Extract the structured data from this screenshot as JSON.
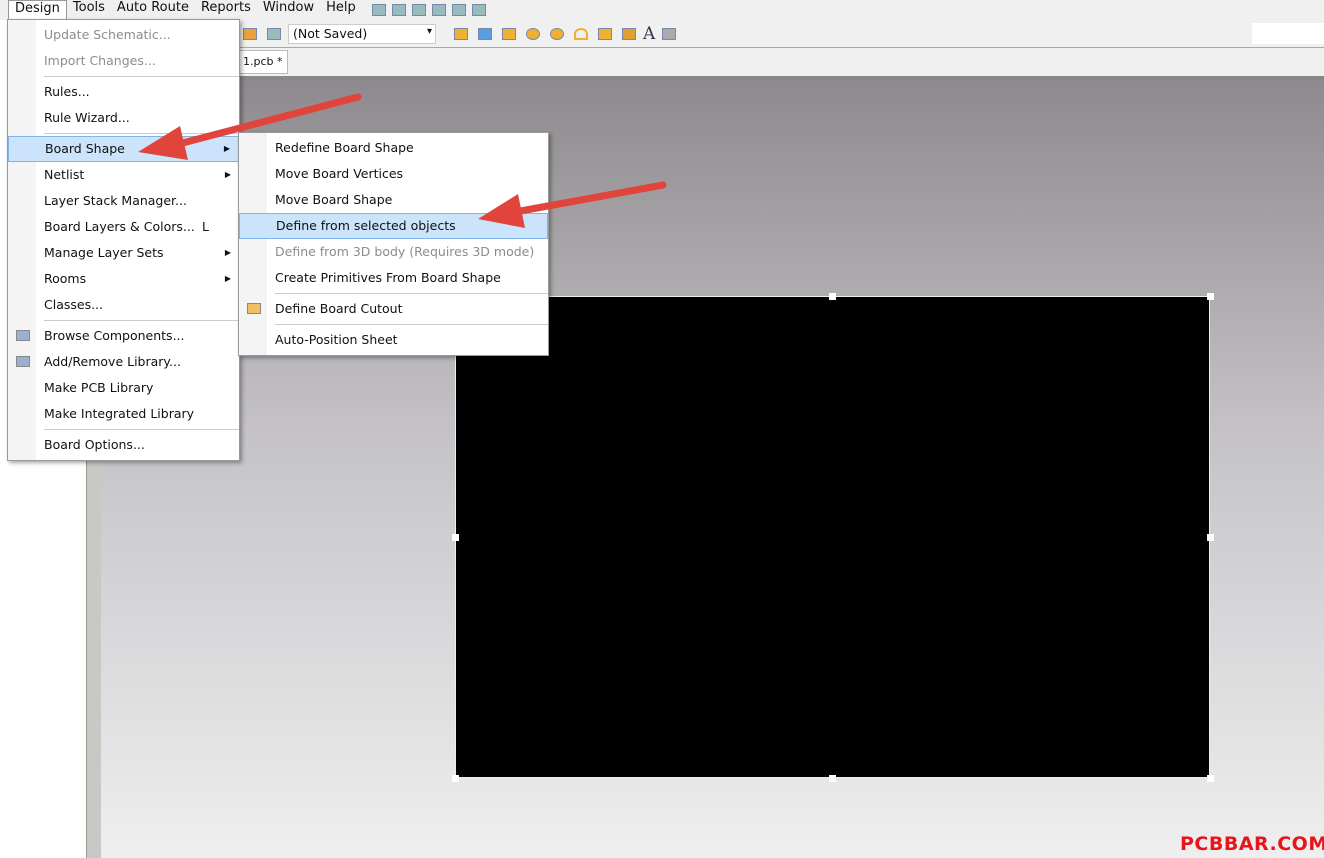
{
  "menubar": {
    "items": [
      "Design",
      "Tools",
      "Auto Route",
      "Reports",
      "Window",
      "Help"
    ]
  },
  "toolbar": {
    "saved_select": "(Not Saved)"
  },
  "document_tab": "1.pcb *",
  "design_menu": {
    "items": [
      {
        "label": "Update Schematic...",
        "disabled": true
      },
      {
        "label": "Import Changes...",
        "disabled": true
      },
      {
        "sep": true
      },
      {
        "label": "Rules..."
      },
      {
        "label": "Rule Wizard..."
      },
      {
        "sep": true
      },
      {
        "label": "Board Shape",
        "submenu": true,
        "highlighted": true
      },
      {
        "label": "Netlist",
        "submenu": true
      },
      {
        "label": "Layer Stack Manager..."
      },
      {
        "label": "Board Layers & Colors...",
        "shortcut": "L"
      },
      {
        "label": "Manage Layer Sets",
        "submenu": true
      },
      {
        "label": "Rooms",
        "submenu": true
      },
      {
        "label": "Classes..."
      },
      {
        "sep": true
      },
      {
        "label": "Browse Components...",
        "icon": "browse-components-icon"
      },
      {
        "label": "Add/Remove Library...",
        "icon": "library-book-icon"
      },
      {
        "label": "Make PCB Library"
      },
      {
        "label": "Make Integrated Library"
      },
      {
        "sep": true
      },
      {
        "label": "Board Options..."
      }
    ]
  },
  "board_shape_submenu": {
    "items": [
      {
        "label": "Redefine Board Shape"
      },
      {
        "label": "Move Board Vertices"
      },
      {
        "label": "Move Board Shape"
      },
      {
        "label": "Define from selected objects",
        "highlighted": true
      },
      {
        "label": "Define from 3D body (Requires 3D mode)",
        "disabled": true
      },
      {
        "label": "Create Primitives From Board Shape"
      },
      {
        "sep": true
      },
      {
        "label": "Define Board Cutout",
        "icon": "board-cutout-icon"
      },
      {
        "sep": true
      },
      {
        "label": "Auto-Position Sheet"
      }
    ]
  },
  "watermark": "PCBBAR.COM",
  "colors": {
    "arrow": "#e0443a",
    "highlight": "#cce4fb",
    "board": "#000000"
  }
}
